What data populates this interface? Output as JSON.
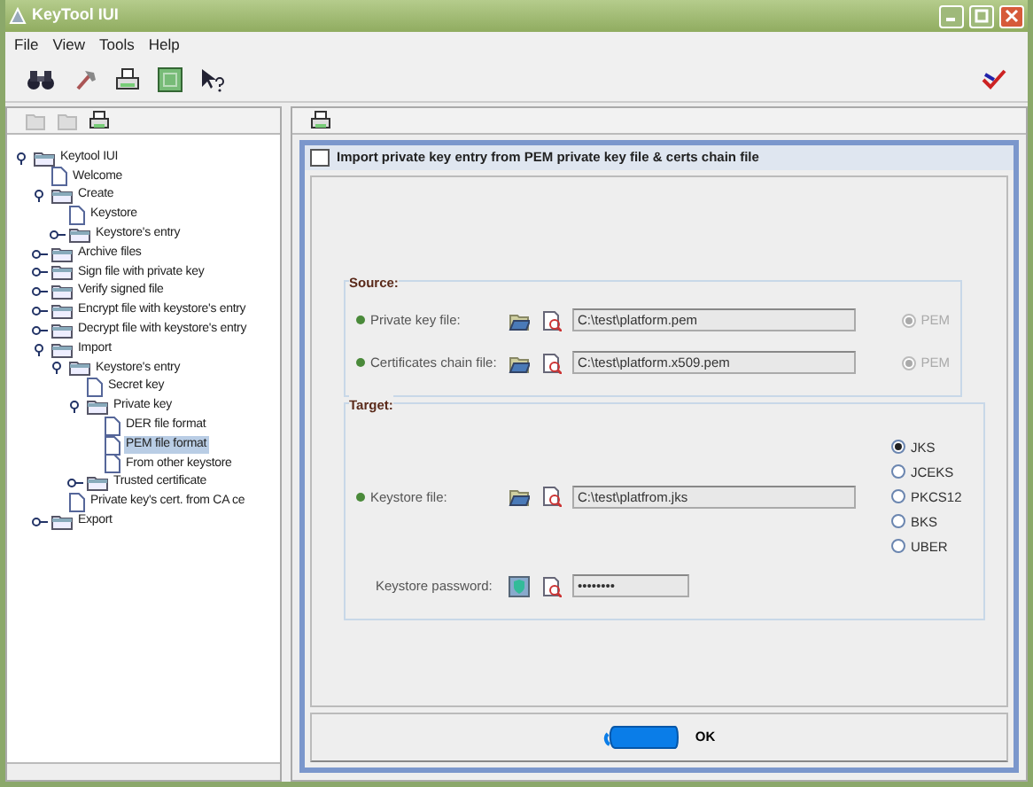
{
  "window": {
    "title": "KeyTool IUI"
  },
  "menu": [
    "File",
    "View",
    "Tools",
    "Help"
  ],
  "tree": [
    {
      "label": "Keytool IUI",
      "kind": "folder",
      "expanded": true,
      "selected": false,
      "children": [
        {
          "label": "Welcome",
          "kind": "doc",
          "selected": false
        },
        {
          "label": "Create",
          "kind": "folder",
          "expanded": true,
          "selected": false,
          "children": [
            {
              "label": "Keystore",
              "kind": "doc",
              "selected": false
            },
            {
              "label": "Keystore's entry",
              "kind": "folder",
              "expanded": false,
              "selected": false
            }
          ]
        },
        {
          "label": "Archive files",
          "kind": "folder",
          "expanded": false,
          "selected": false
        },
        {
          "label": "Sign file with private key",
          "kind": "folder",
          "expanded": false,
          "selected": false
        },
        {
          "label": "Verify signed file",
          "kind": "folder",
          "expanded": false,
          "selected": false
        },
        {
          "label": "Encrypt file with keystore's entry",
          "kind": "folder",
          "expanded": false,
          "selected": false
        },
        {
          "label": "Decrypt file with keystore's entry",
          "kind": "folder",
          "expanded": false,
          "selected": false
        },
        {
          "label": "Import",
          "kind": "folder",
          "expanded": true,
          "selected": false,
          "children": [
            {
              "label": "Keystore's entry",
              "kind": "folder",
              "expanded": true,
              "selected": false,
              "children": [
                {
                  "label": "Secret key",
                  "kind": "doc",
                  "selected": false
                },
                {
                  "label": "Private key",
                  "kind": "folder",
                  "expanded": true,
                  "selected": false,
                  "children": [
                    {
                      "label": "DER file format",
                      "kind": "doc",
                      "selected": false
                    },
                    {
                      "label": "PEM file format",
                      "kind": "doc",
                      "selected": true
                    },
                    {
                      "label": "From other keystore",
                      "kind": "doc",
                      "selected": false
                    }
                  ]
                },
                {
                  "label": "Trusted certificate",
                  "kind": "folder",
                  "expanded": false,
                  "selected": false
                }
              ]
            },
            {
              "label": "Private key's cert. from CA ce",
              "kind": "doc",
              "selected": false
            }
          ]
        },
        {
          "label": "Export",
          "kind": "folder",
          "expanded": false,
          "selected": false
        }
      ]
    }
  ],
  "panel": {
    "title": "Import private key entry from PEM private key file & certs chain file",
    "source": {
      "legend": "Source:",
      "rows": [
        {
          "label": "Private key file:",
          "value": "C:\\test\\platform.pem",
          "format": {
            "label": "PEM",
            "selected": true,
            "disabled": true
          }
        },
        {
          "label": "Certificates chain file:",
          "value": "C:\\test\\platform.x509.pem",
          "format": {
            "label": "PEM",
            "selected": true,
            "disabled": true
          }
        }
      ]
    },
    "target": {
      "legend": "Target:",
      "keystore_label": "Keystore file:",
      "keystore_value": "C:\\test\\platfrom.jks",
      "types": [
        {
          "label": "JKS",
          "selected": true
        },
        {
          "label": "JCEKS",
          "selected": false
        },
        {
          "label": "PKCS12",
          "selected": false
        },
        {
          "label": "BKS",
          "selected": false
        },
        {
          "label": "UBER",
          "selected": false
        }
      ],
      "password_label": "Keystore password:",
      "password_value": "••••••••"
    },
    "ok": "OK"
  }
}
